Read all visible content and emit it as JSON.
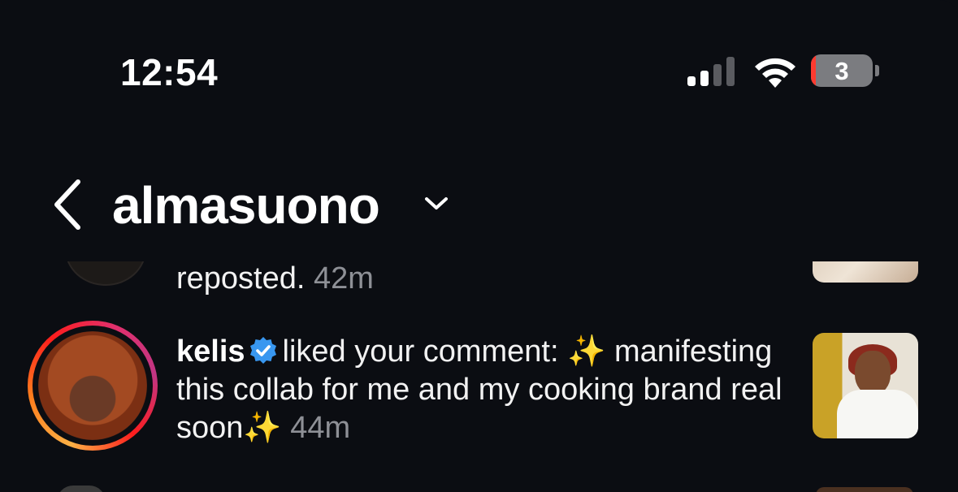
{
  "status_bar": {
    "time": "12:54",
    "battery_level": "3",
    "icons": [
      "cellular-signal-icon",
      "wifi-icon",
      "battery-icon"
    ]
  },
  "header": {
    "title": "almasuono",
    "back_icon": "chevron-left-icon",
    "dropdown_icon": "chevron-down-icon"
  },
  "notifications": [
    {
      "text": "reposted.",
      "time": "42m"
    },
    {
      "username": "kelis",
      "verified": true,
      "action": "liked your comment: ✨ manifesting this collab for me and my cooking brand real soon✨",
      "time": "44m"
    }
  ],
  "colors": {
    "background": "#0b0d12",
    "muted_text": "#8e9096",
    "verified_blue": "#3897f0",
    "battery_low": "#ff3b30"
  }
}
